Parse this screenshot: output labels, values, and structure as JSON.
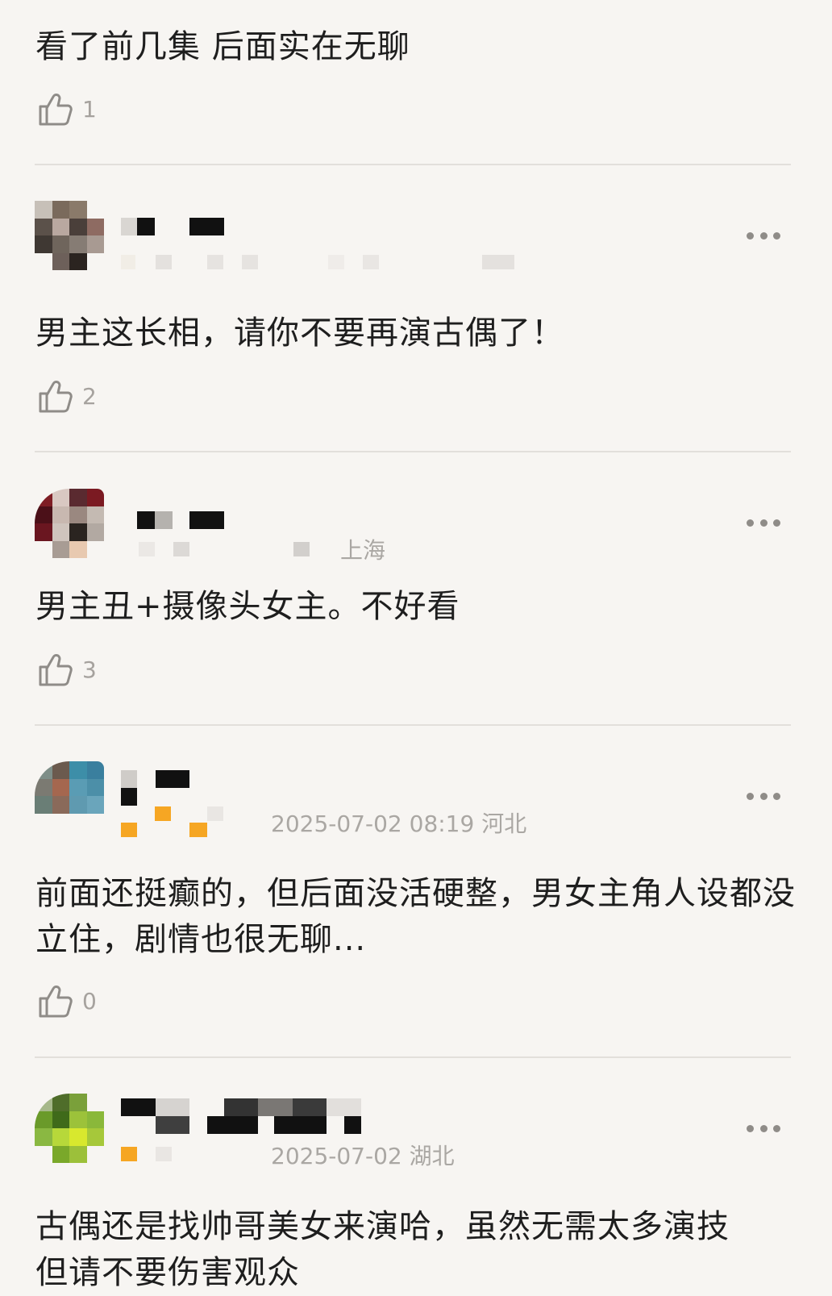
{
  "comments": [
    {
      "text": "看了前几集 后面实在无聊",
      "likes": "1"
    },
    {
      "meta": "",
      "text": "男主这长相，请你不要再演古偶了！",
      "likes": "2"
    },
    {
      "meta": "上海",
      "text": "男主丑+摄像头女主。不好看",
      "likes": "3"
    },
    {
      "meta": "2025-07-02 08:19 河北",
      "text": "前面还挺癫的，但后面没活硬整，男女主角人设都没立住，剧情也很无聊...",
      "likes": "0"
    },
    {
      "meta": "2025-07-02 湖北",
      "text": "古偶还是找帅哥美女来演哈，虽然无需太多演技",
      "text2": "但请不要伤害观众"
    }
  ],
  "icons": {
    "like": "thumbs-up-icon",
    "more": "more-dots-icon"
  },
  "colors": {
    "background": "#f7f5f2",
    "divider": "#e2dfdb",
    "meta": "#aaa7a3"
  }
}
